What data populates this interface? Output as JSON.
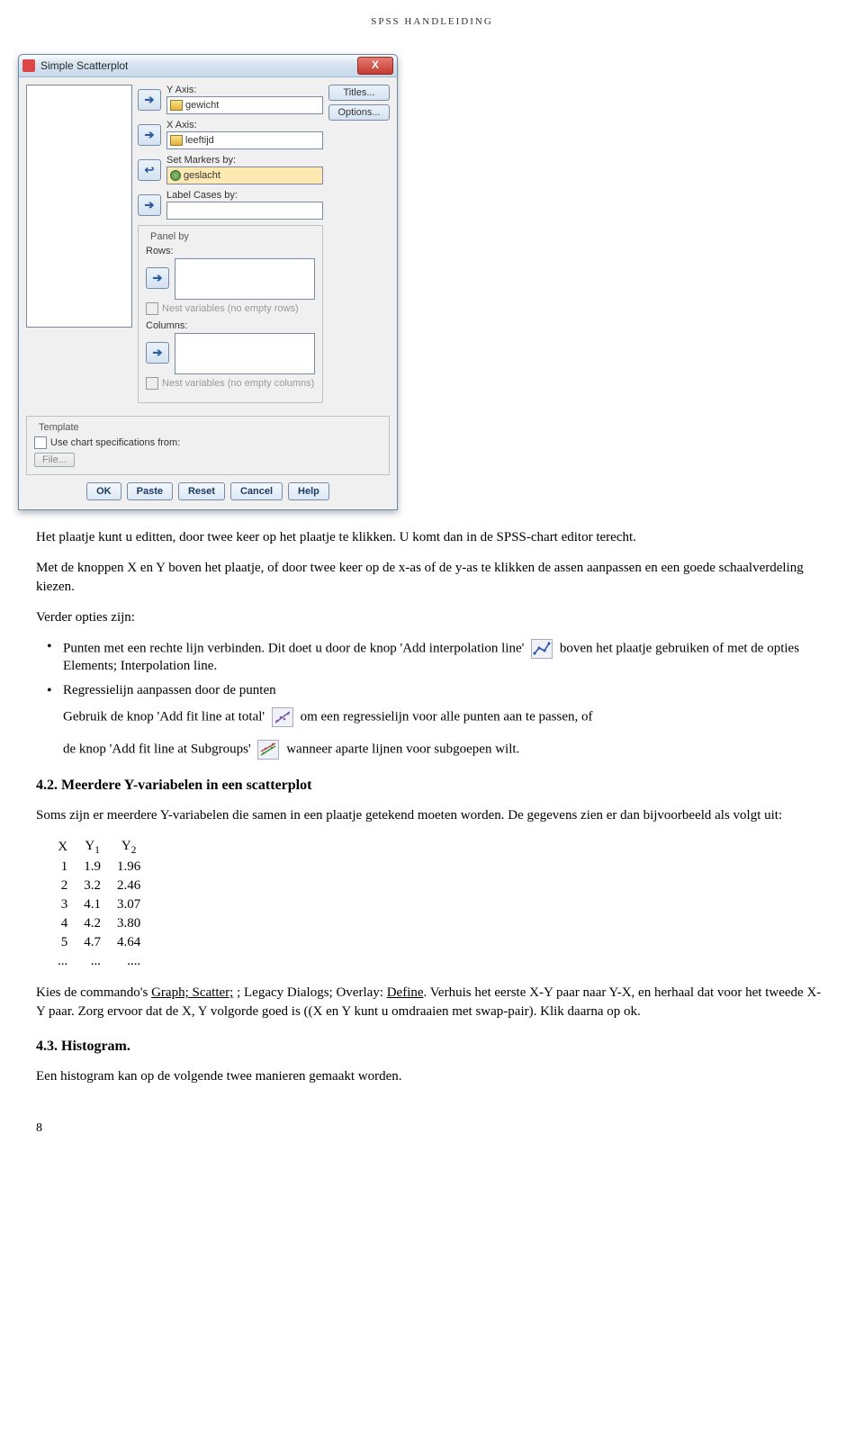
{
  "header": "SPSS HANDLEIDING",
  "dialog": {
    "title": "Simple Scatterplot",
    "close": "X",
    "side": {
      "titles": "Titles...",
      "options": "Options..."
    },
    "labels": {
      "yaxis": "Y Axis:",
      "xaxis": "X Axis:",
      "setmarkers": "Set Markers by:",
      "labelcases": "Label Cases by:",
      "panelby": "Panel by",
      "rows": "Rows:",
      "nestrows": "Nest variables (no empty rows)",
      "columns": "Columns:",
      "nestcols": "Nest variables (no empty columns)",
      "template": "Template",
      "usechart": "Use chart specifications from:",
      "file": "File..."
    },
    "values": {
      "yaxis": "gewicht",
      "xaxis": "leeftijd",
      "setmarkers": "geslacht",
      "labelcases": ""
    },
    "buttons": {
      "ok": "OK",
      "paste": "Paste",
      "reset": "Reset",
      "cancel": "Cancel",
      "help": "Help"
    }
  },
  "para1": "Het plaatje kunt u editten, door twee keer op het plaatje te klikken. U komt dan in de SPSS-chart editor terecht.",
  "para2": "Met de knoppen X en Y boven het plaatje, of door twee keer op de x-as of de y-as te klikken de assen aanpassen en een goede schaalverdeling kiezen.",
  "para3": "Verder opties zijn:",
  "bullet1a": "Punten met een rechte lijn verbinden. Dit doet u door de knop 'Add interpolation line'",
  "bullet1b": " boven het plaatje gebruiken of met de opties Elements; Interpolation line.",
  "bullet2_title": "Regressielijn aanpassen door de punten",
  "bullet2_line1a": "Gebruik de knop 'Add fit line at total'",
  "bullet2_line1b": " om een regressielijn voor alle punten aan te passen, of",
  "bullet2_line2a": "de knop 'Add fit line at Subgroups'",
  "bullet2_line2b": " wanneer aparte lijnen voor subgoepen wilt.",
  "heading42": "4.2.  Meerdere Y-variabelen in een scatterplot",
  "para4": "Soms zijn er meerdere Y-variabelen die samen in een plaatje getekend moeten worden. De gegevens zien er dan bijvoorbeeld als volgt uit:",
  "table": {
    "headers": [
      "X",
      "Y1",
      "Y2"
    ],
    "rows": [
      [
        "1",
        "1.9",
        "1.96"
      ],
      [
        "2",
        "3.2",
        "2.46"
      ],
      [
        "3",
        "4.1",
        "3.07"
      ],
      [
        "4",
        "4.2",
        "3.80"
      ],
      [
        "5",
        "4.7",
        "4.64"
      ],
      [
        "...",
        "...",
        "...."
      ]
    ]
  },
  "para5a": "Kies de commando's ",
  "para5_graph": "Graph;",
  "para5_scatter": " Scatter;",
  "para5_mid": " ; Legacy Dialogs; Overlay: ",
  "para5_define": "Define",
  "para5b": ". Verhuis het eerste X-Y paar naar Y-X, en herhaal dat voor het tweede X-Y paar. Zorg ervoor dat de X, Y volgorde goed is ((X en Y kunt u omdraaien met swap-pair). Klik daarna op ok.",
  "heading43": "4.3.  Histogram.",
  "para6": "Een histogram kan op de volgende twee manieren gemaakt worden.",
  "pagenum": "8"
}
